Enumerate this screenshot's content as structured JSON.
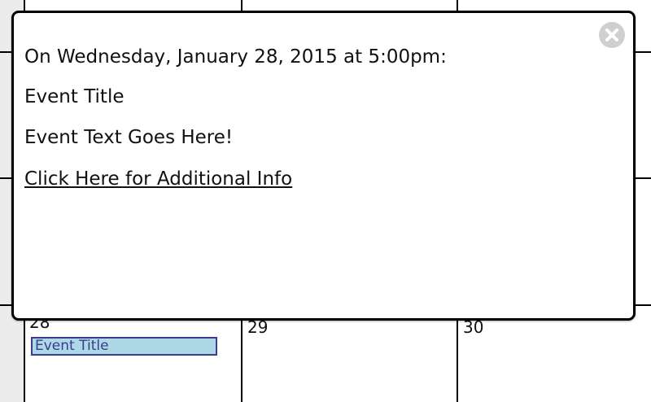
{
  "calendar": {
    "days": [
      {
        "number": "28",
        "events": [
          "Event Title"
        ]
      },
      {
        "number": "29",
        "events": []
      },
      {
        "number": "30",
        "events": []
      }
    ]
  },
  "popup": {
    "datetime_line": "On Wednesday, January 28, 2015 at 5:00pm:",
    "event_title": "Event Title",
    "event_text": "Event Text Goes Here!",
    "more_info_link": "Click Here for Additional Info",
    "close_icon": "close-x-circle-icon"
  }
}
